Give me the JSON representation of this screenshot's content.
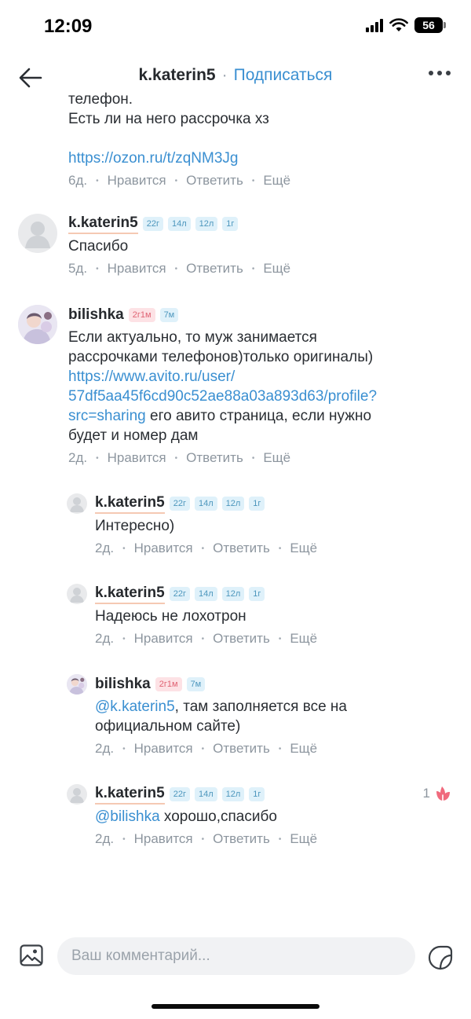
{
  "status_bar": {
    "time": "12:09",
    "battery": "56"
  },
  "header": {
    "username": "k.katerin5",
    "separator": "·",
    "subscribe": "Подписаться"
  },
  "actions": {
    "like": "Нравится",
    "reply": "Ответить",
    "more": "Ещё",
    "sep": "•"
  },
  "comments": [
    {
      "lines": [
        "телефон.",
        "Есть ли на него рассрочка хз"
      ],
      "link": "https://ozon.ru/t/zqNM3Jg",
      "time": "6д."
    },
    {
      "author": "k.katerin5",
      "badges": [
        "22г",
        "14л",
        "12л",
        "1г"
      ],
      "text": "Спасибо",
      "time": "5д."
    },
    {
      "author": "bilishka",
      "badges": [
        "2г1м",
        "7м"
      ],
      "text_lines": [
        "Если актуально, то муж занимается",
        "рассрочками телефонов)только оригиналы)"
      ],
      "link_lines": [
        "https://www.avito.ru/user/",
        "57df5aa45f6cd90c52ae88a03a893d63/profile?",
        "src=sharing"
      ],
      "after_link": " его авито страница, если нужно",
      "last_line": "будет и номер дам",
      "time": "2д."
    },
    {
      "author": "k.katerin5",
      "badges": [
        "22г",
        "14л",
        "12л",
        "1г"
      ],
      "text": "Интересно)",
      "time": "2д."
    },
    {
      "author": "k.katerin5",
      "badges": [
        "22г",
        "14л",
        "12л",
        "1г"
      ],
      "text": "Надеюсь не лохотрон",
      "time": "2д."
    },
    {
      "author": "bilishka",
      "badges": [
        "2г1м",
        "7м"
      ],
      "mention": "@k.katerin5",
      "text_after": ", там заполняется все на",
      "text_line2": "официальном сайте)",
      "time": "2д."
    },
    {
      "author": "k.katerin5",
      "badges": [
        "22г",
        "14л",
        "12л",
        "1г"
      ],
      "mention": "@bilishka",
      "text_after": " хорошо,спасибо",
      "time": "2д.",
      "likes": "1"
    }
  ],
  "composer": {
    "placeholder": "Ваш комментарий..."
  }
}
